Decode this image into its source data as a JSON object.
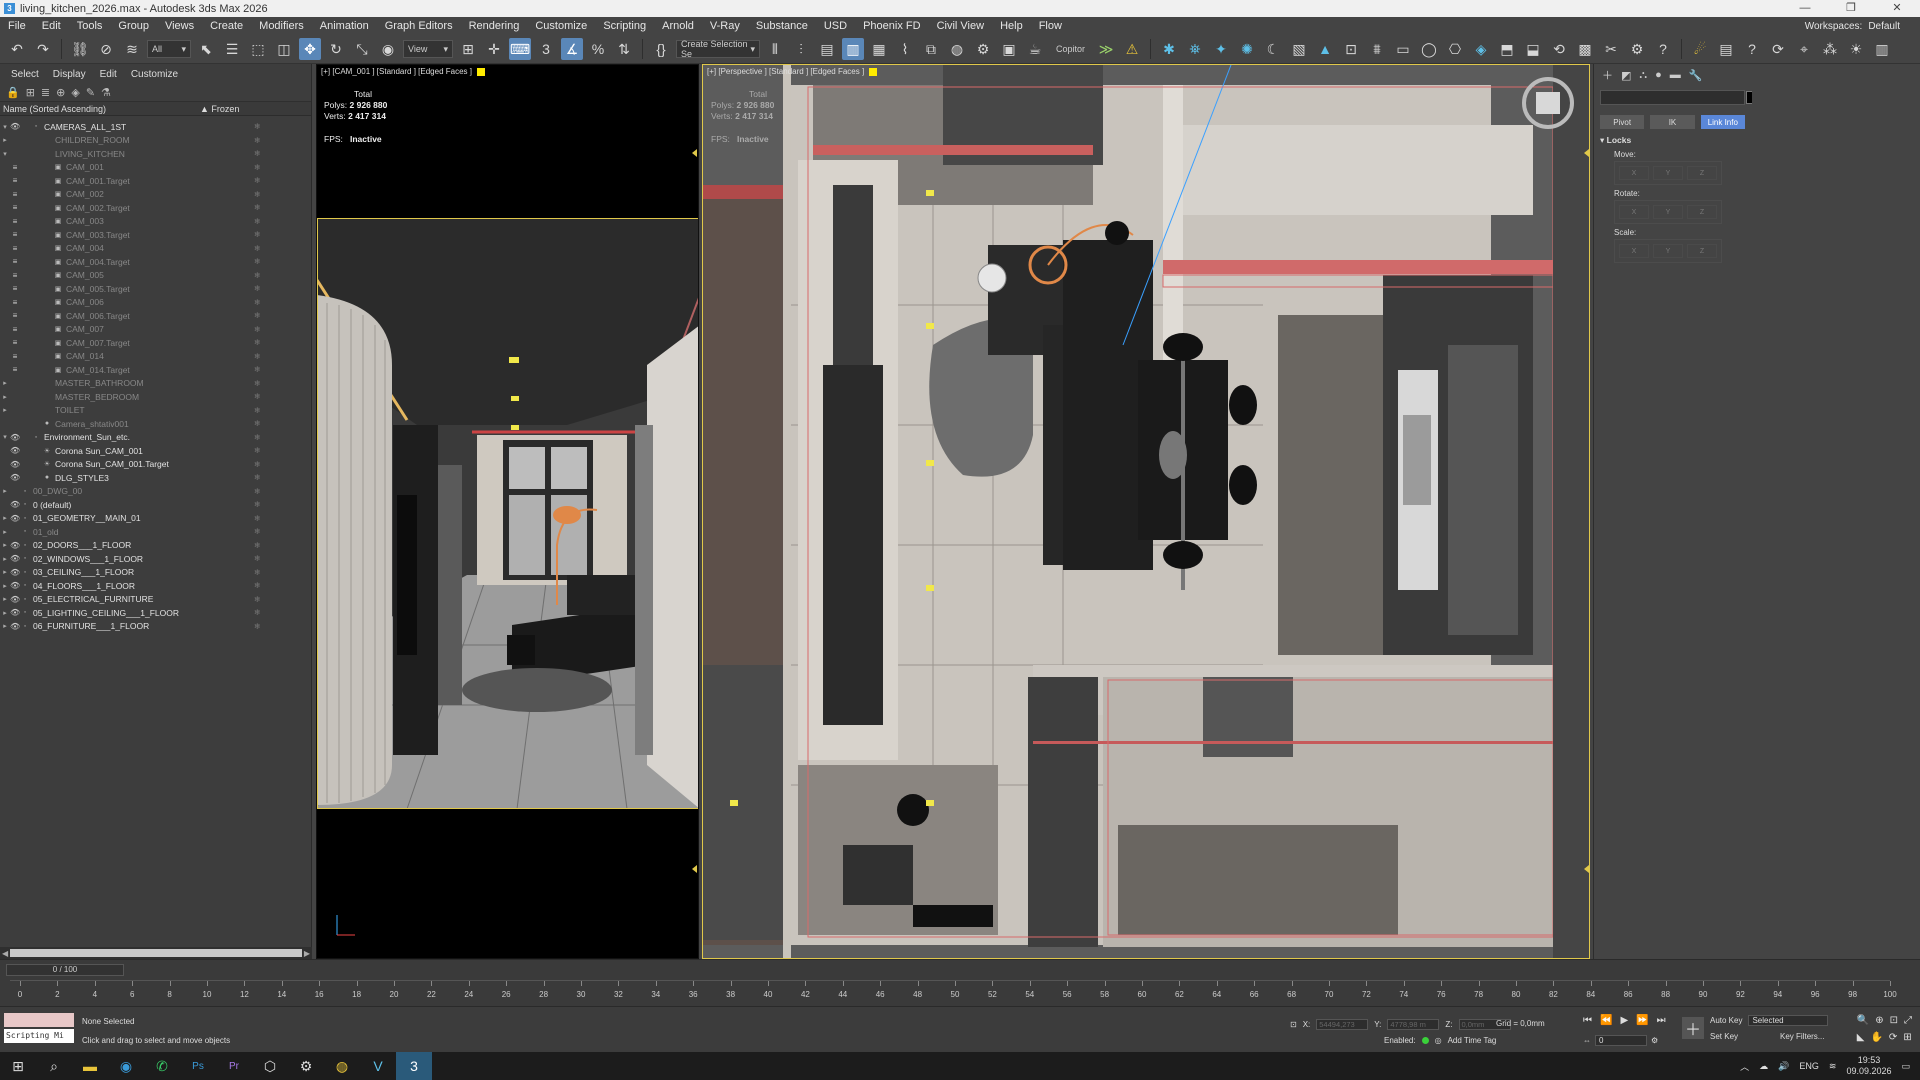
{
  "window": {
    "title": "living_kitchen_2026.max - Autodesk 3ds Max 2026",
    "controls": [
      "—",
      "❐",
      "✕"
    ]
  },
  "menu": {
    "items": [
      "File",
      "Edit",
      "Tools",
      "Group",
      "Views",
      "Create",
      "Modifiers",
      "Animation",
      "Graph Editors",
      "Rendering",
      "Customize",
      "Scripting",
      "Arnold",
      "V-Ray",
      "Substance",
      "USD",
      "Phoenix FD",
      "Civil View",
      "Help",
      "Flow"
    ],
    "workspaces_label": "Workspaces:",
    "workspaces_value": "Default"
  },
  "toolbar": {
    "filter_value": "All",
    "refcoord_value": "View",
    "selection_set_value": "Create Selection Se",
    "copitor_label": "Copitor"
  },
  "scene_explorer": {
    "tabs": [
      "Select",
      "Display",
      "Edit",
      "Customize"
    ],
    "column_name": "Name (Sorted Ascending)",
    "column_frozen": "▲ Frozen",
    "rows": [
      {
        "label": "CAMERAS_ALL_1ST",
        "indent": 1,
        "expand": "▾",
        "vis": "👁",
        "icon": "◦",
        "dim": false
      },
      {
        "label": "CHILDREN_ROOM",
        "indent": 2,
        "expand": "▸",
        "vis": "",
        "icon": "",
        "dim": true
      },
      {
        "label": "LIVING_KITCHEN",
        "indent": 2,
        "expand": "▾",
        "vis": "",
        "icon": "",
        "dim": true
      },
      {
        "label": "CAM_001",
        "indent": 3,
        "expand": "",
        "vis": "≡",
        "icon": "▣",
        "dim": true
      },
      {
        "label": "CAM_001.Target",
        "indent": 3,
        "expand": "",
        "vis": "≡",
        "icon": "▣",
        "dim": true
      },
      {
        "label": "CAM_002",
        "indent": 3,
        "expand": "",
        "vis": "≡",
        "icon": "▣",
        "dim": true
      },
      {
        "label": "CAM_002.Target",
        "indent": 3,
        "expand": "",
        "vis": "≡",
        "icon": "▣",
        "dim": true
      },
      {
        "label": "CAM_003",
        "indent": 3,
        "expand": "",
        "vis": "≡",
        "icon": "▣",
        "dim": true
      },
      {
        "label": "CAM_003.Target",
        "indent": 3,
        "expand": "",
        "vis": "≡",
        "icon": "▣",
        "dim": true
      },
      {
        "label": "CAM_004",
        "indent": 3,
        "expand": "",
        "vis": "≡",
        "icon": "▣",
        "dim": true
      },
      {
        "label": "CAM_004.Target",
        "indent": 3,
        "expand": "",
        "vis": "≡",
        "icon": "▣",
        "dim": true
      },
      {
        "label": "CAM_005",
        "indent": 3,
        "expand": "",
        "vis": "≡",
        "icon": "▣",
        "dim": true
      },
      {
        "label": "CAM_005.Target",
        "indent": 3,
        "expand": "",
        "vis": "≡",
        "icon": "▣",
        "dim": true
      },
      {
        "label": "CAM_006",
        "indent": 3,
        "expand": "",
        "vis": "≡",
        "icon": "▣",
        "dim": true
      },
      {
        "label": "CAM_006.Target",
        "indent": 3,
        "expand": "",
        "vis": "≡",
        "icon": "▣",
        "dim": true
      },
      {
        "label": "CAM_007",
        "indent": 3,
        "expand": "",
        "vis": "≡",
        "icon": "▣",
        "dim": true
      },
      {
        "label": "CAM_007.Target",
        "indent": 3,
        "expand": "",
        "vis": "≡",
        "icon": "▣",
        "dim": true
      },
      {
        "label": "CAM_014",
        "indent": 3,
        "expand": "",
        "vis": "≡",
        "icon": "▣",
        "dim": true
      },
      {
        "label": "CAM_014.Target",
        "indent": 3,
        "expand": "",
        "vis": "≡",
        "icon": "▣",
        "dim": true
      },
      {
        "label": "MASTER_BATHROOM",
        "indent": 2,
        "expand": "▸",
        "vis": "",
        "icon": "",
        "dim": true
      },
      {
        "label": "MASTER_BEDROOM",
        "indent": 2,
        "expand": "▸",
        "vis": "",
        "icon": "",
        "dim": true
      },
      {
        "label": "TOILET",
        "indent": 2,
        "expand": "▸",
        "vis": "",
        "icon": "",
        "dim": true
      },
      {
        "label": "Camera_shtativ001",
        "indent": 2,
        "expand": "",
        "vis": "",
        "icon": "●",
        "dim": true
      },
      {
        "label": "Environment_Sun_etc.",
        "indent": 1,
        "expand": "▾",
        "vis": "👁",
        "icon": "◦",
        "dim": false
      },
      {
        "label": "Corona Sun_CAM_001",
        "indent": 2,
        "expand": "",
        "vis": "👁",
        "icon": "☀",
        "dim": false
      },
      {
        "label": "Corona Sun_CAM_001.Target",
        "indent": 2,
        "expand": "",
        "vis": "👁",
        "icon": "☀",
        "dim": false
      },
      {
        "label": "DLG_STYLE3",
        "indent": 2,
        "expand": "",
        "vis": "👁",
        "icon": "●",
        "dim": false
      },
      {
        "label": "00_DWG_00",
        "indent": 0,
        "expand": "▸",
        "vis": "",
        "icon": "◦",
        "dim": true
      },
      {
        "label": "0 (default)",
        "indent": 0,
        "expand": "",
        "vis": "👁",
        "icon": "◦",
        "dim": false
      },
      {
        "label": "01_GEOMETRY__MAIN_01",
        "indent": 0,
        "expand": "▸",
        "vis": "👁",
        "icon": "◦",
        "dim": false
      },
      {
        "label": "01_old",
        "indent": 0,
        "expand": "▸",
        "vis": "",
        "icon": "◦",
        "dim": true
      },
      {
        "label": "02_DOORS___1_FLOOR",
        "indent": 0,
        "expand": "▸",
        "vis": "👁",
        "icon": "◦",
        "dim": false
      },
      {
        "label": "02_WINDOWS___1_FLOOR",
        "indent": 0,
        "expand": "▸",
        "vis": "👁",
        "icon": "◦",
        "dim": false
      },
      {
        "label": "03_CEILING___1_FLOOR",
        "indent": 0,
        "expand": "▸",
        "vis": "👁",
        "icon": "◦",
        "dim": false
      },
      {
        "label": "04_FLOORS___1_FLOOR",
        "indent": 0,
        "expand": "▸",
        "vis": "👁",
        "icon": "◦",
        "dim": false
      },
      {
        "label": "05_ELECTRICAL_FURNITURE",
        "indent": 0,
        "expand": "▸",
        "vis": "👁",
        "icon": "◦",
        "dim": false
      },
      {
        "label": "05_LIGHTING_CEILING___1_FLOOR",
        "indent": 0,
        "expand": "▸",
        "vis": "👁",
        "icon": "◦",
        "dim": false
      },
      {
        "label": "06_FURNITURE___1_FLOOR",
        "indent": 0,
        "expand": "▸",
        "vis": "👁",
        "icon": "◦",
        "dim": false
      }
    ]
  },
  "viewport_cam": {
    "label": "[+] [CAM_001 ] [Standard ] [Edged Faces ]",
    "total_label": "Total",
    "polys_label": "Polys:",
    "polys_value": "2 926 880",
    "verts_label": "Verts:",
    "verts_value": "2 417 314",
    "fps_label": "FPS:",
    "fps_value": "Inactive"
  },
  "viewport_persp": {
    "label": "[+] [Perspective ] [Standard ] [Edged Faces ]",
    "total_label": "Total",
    "polys_label": "Polys:",
    "polys_value": "2 926 880",
    "verts_label": "Verts:",
    "verts_value": "2 417 314",
    "fps_label": "FPS:",
    "fps_value": "Inactive"
  },
  "command_panel": {
    "pivot_label": "Pivot",
    "ik_label": "IK",
    "linkinfo_label": "Link Info",
    "locks_title": "Locks",
    "move_label": "Move:",
    "rotate_label": "Rotate:",
    "scale_label": "Scale:",
    "axes": [
      "X",
      "Y",
      "Z"
    ]
  },
  "timeline": {
    "slider_label": "0 / 100",
    "ticks": [
      0,
      2,
      4,
      6,
      8,
      10,
      12,
      14,
      16,
      18,
      20,
      22,
      24,
      26,
      28,
      30,
      32,
      34,
      36,
      38,
      40,
      42,
      44,
      46,
      48,
      50,
      52,
      54,
      56,
      58,
      60,
      62,
      64,
      66,
      68,
      70,
      72,
      74,
      76,
      78,
      80,
      82,
      84,
      86,
      88,
      90,
      92,
      94,
      96,
      98,
      100
    ]
  },
  "status": {
    "script_label": "Scripting Mi",
    "selection_text": "None Selected",
    "hint_text": "Click and drag to select and move objects",
    "x_label": "X:",
    "x_value": "54494,273",
    "y_label": "Y:",
    "y_value": "4778,98 m",
    "z_label": "Z:",
    "z_value": "0,0mm",
    "grid_text": "Grid = 0,0mm",
    "enabled_label": "Enabled:",
    "add_time_tag": "Add Time Tag",
    "autokey_label": "Auto Key",
    "setkey_label": "Set Key",
    "selected_value": "Selected",
    "keyfilters_label": "Key Filters...",
    "frame_value": "0"
  },
  "taskbar": {
    "language": "ENG",
    "time": "19:53",
    "date": "09.09.2026"
  }
}
